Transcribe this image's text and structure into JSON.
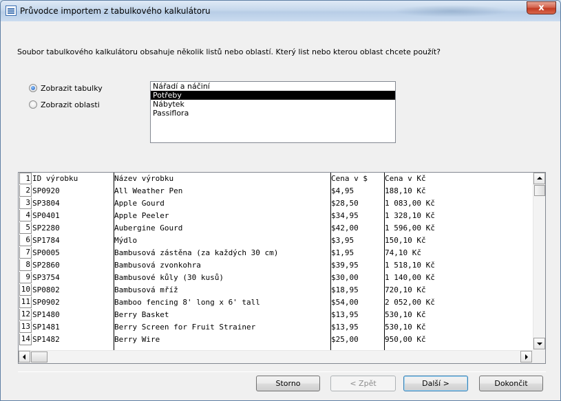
{
  "window": {
    "title": "Průvodce importem z tabulkového kalkulátoru",
    "close_label": "x"
  },
  "question": "Soubor tabulkového kalkulátoru obsahuje několik listů nebo oblastí. Který list nebo kterou oblast chcete použít?",
  "options": {
    "show_sheets": {
      "label": "Zobrazit tabulky",
      "checked": true
    },
    "show_ranges": {
      "label": "Zobrazit oblasti",
      "checked": false
    }
  },
  "sheets": {
    "items": [
      "Nářadí a náčiní",
      "Potřeby",
      "Nábytek",
      "Passiflora"
    ],
    "selected": "Potřeby"
  },
  "preview": {
    "rows": [
      {
        "num": "1",
        "id": "ID výrobku",
        "name": "Název výrobku",
        "price_usd": "Cena v $",
        "price_czk": "Cena v Kč"
      },
      {
        "num": "2",
        "id": "SP0920",
        "name": "All Weather Pen",
        "price_usd": "$4,95",
        "price_czk": "188,10 Kč"
      },
      {
        "num": "3",
        "id": "SP3804",
        "name": "Apple Gourd",
        "price_usd": "$28,50",
        "price_czk": "1 083,00 Kč"
      },
      {
        "num": "4",
        "id": "SP0401",
        "name": "Apple Peeler",
        "price_usd": "$34,95",
        "price_czk": "1 328,10 Kč"
      },
      {
        "num": "5",
        "id": "SP2280",
        "name": "Aubergine Gourd",
        "price_usd": "$42,00",
        "price_czk": "1 596,00 Kč"
      },
      {
        "num": "6",
        "id": "SP1784",
        "name": "Mýdlo",
        "price_usd": "$3,95",
        "price_czk": "150,10 Kč"
      },
      {
        "num": "7",
        "id": "SP0005",
        "name": "Bambusová zástěna (za každých 30 cm)",
        "price_usd": "$1,95",
        "price_czk": "74,10 Kč"
      },
      {
        "num": "8",
        "id": "SP2860",
        "name": "Bambusová zvonkohra",
        "price_usd": "$39,95",
        "price_czk": "1 518,10 Kč"
      },
      {
        "num": "9",
        "id": "SP3754",
        "name": "Bambusové kůly (30 kusů)",
        "price_usd": "$30,00",
        "price_czk": "1 140,00 Kč"
      },
      {
        "num": "10",
        "id": "SP0802",
        "name": "Bambusová mříž",
        "price_usd": "$18,95",
        "price_czk": "720,10 Kč"
      },
      {
        "num": "11",
        "id": "SP0902",
        "name": "Bamboo fencing 8' long x 6' tall",
        "price_usd": "$54,00",
        "price_czk": "2 052,00 Kč"
      },
      {
        "num": "12",
        "id": "SP1480",
        "name": "Berry Basket",
        "price_usd": "$13,95",
        "price_czk": "530,10 Kč"
      },
      {
        "num": "13",
        "id": "SP1481",
        "name": "Berry Screen for Fruit Strainer",
        "price_usd": "$13,95",
        "price_czk": "530,10 Kč"
      },
      {
        "num": "14",
        "id": "SP1482",
        "name": "Berry Wire",
        "price_usd": "$25,00",
        "price_czk": "950,00 Kč"
      }
    ]
  },
  "buttons": {
    "cancel": "Storno",
    "back": "< Zpět",
    "next": "Další >",
    "finish": "Dokončit"
  }
}
